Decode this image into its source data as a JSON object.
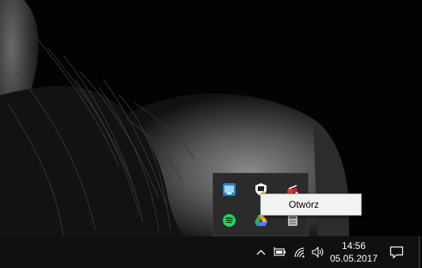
{
  "tray_flyout": {
    "icons": [
      "intel-graphics-icon",
      "security-shield-icon",
      "network-app-icon",
      "spotify-icon",
      "google-drive-icon",
      "storage-drive-icon"
    ]
  },
  "context_menu": {
    "items": [
      {
        "label": "Otwórz"
      }
    ]
  },
  "taskbar": {
    "tray_icons": [
      "chevron-up-icon",
      "battery-icon",
      "wifi-icon",
      "volume-icon"
    ],
    "clock": {
      "time": "14:56",
      "date": "05.05.2017"
    },
    "notification_icon": "action-center-icon"
  },
  "colors": {
    "taskbar_bg": "#101010",
    "flyout_bg": "#2b2b2b",
    "menu_bg": "#f2f2f2",
    "spotify_green": "#1ed760",
    "intel_blue": "#1e88c8"
  }
}
